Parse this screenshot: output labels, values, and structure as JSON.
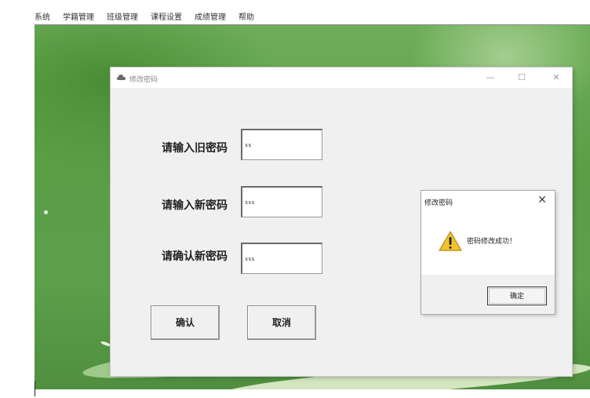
{
  "menu": {
    "items": [
      {
        "label": "系统"
      },
      {
        "label": "学籍管理"
      },
      {
        "label": "班级管理"
      },
      {
        "label": "课程设置"
      },
      {
        "label": "成绩管理"
      },
      {
        "label": "帮助"
      }
    ]
  },
  "main_window": {
    "title": "修改密码",
    "controls": {
      "minimize": "—",
      "maximize": "☐",
      "close": "✕"
    },
    "fields": {
      "old_password": {
        "label": "请输入旧密码",
        "value": "ss"
      },
      "new_password": {
        "label": "请输入新密码",
        "value": "sss"
      },
      "confirm_password": {
        "label": "请确认新密码",
        "value": "sss"
      }
    },
    "buttons": {
      "confirm": "确认",
      "cancel": "取消"
    }
  },
  "message_box": {
    "title": "修改密码",
    "close": "✕",
    "message": "密码修改成功！",
    "ok_label": "确定"
  },
  "colors": {
    "desktop": "#5d9f4b",
    "window_bg": "#f0f0f0",
    "warning": "#f2c230"
  }
}
